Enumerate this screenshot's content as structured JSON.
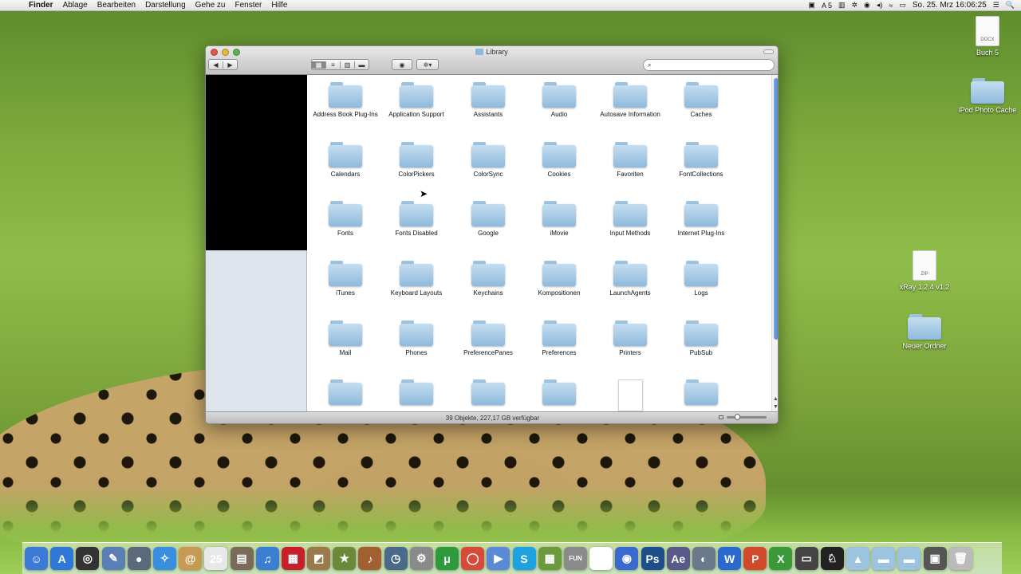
{
  "menubar": {
    "apple": "",
    "menus": [
      "Finder",
      "Ablage",
      "Bearbeiten",
      "Darstellung",
      "Gehe zu",
      "Fenster",
      "Hilfe"
    ],
    "status_icons": [
      "▣",
      "A 5",
      "▥",
      "✲",
      "◉",
      "◂)",
      "≈",
      "▭"
    ],
    "clock": "So. 25. Mrz  16:06:25",
    "search_icon": "🔍",
    "list_icon": "☰"
  },
  "desktop": {
    "icons": [
      {
        "label": "Buch 5",
        "badge": "DOCX"
      },
      {
        "label": "iPod Photo Cache"
      },
      {
        "label": "xRay 1.2.4 v1.2",
        "badge": "ZIP"
      },
      {
        "label": "Neuer Ordner"
      }
    ]
  },
  "window": {
    "title": "Library",
    "toolbar": {
      "back": "◀",
      "forward": "▶",
      "views": [
        "▦",
        "≡",
        "▥",
        "▬"
      ],
      "quicklook": "◉",
      "action": "✲▾",
      "search_icon": "⌕",
      "search_placeholder": ""
    },
    "status": "39 Objekte, 227,17 GB verfügbar",
    "scroll_up": "▲",
    "scroll_down": "▼",
    "items": [
      "Address Book Plug-Ins",
      "Application Support",
      "Assistants",
      "Audio",
      "Autosave Information",
      "Caches",
      "Calendars",
      "ColorPickers",
      "ColorSync",
      "Cookies",
      "Favoriten",
      "FontCollections",
      "Fonts",
      "Fonts Disabled",
      "Google",
      "iMovie",
      "Input Methods",
      "Internet Plug-Ins",
      "iTunes",
      "Keyboard Layouts",
      "Keychains",
      "Kompositionen",
      "LaunchAgents",
      "Logs",
      "Mail",
      "Phones",
      "PreferencePanes",
      "Preferences",
      "Printers",
      "PubSub"
    ]
  },
  "cursor": "➤",
  "dock": {
    "icons": [
      {
        "glyph": "☺",
        "color": "#3b7bd6"
      },
      {
        "glyph": "A",
        "color": "#2f78d8"
      },
      {
        "glyph": "◎",
        "color": "#333333"
      },
      {
        "glyph": "✎",
        "color": "#5a7fb5"
      },
      {
        "glyph": "●",
        "color": "#5a6a7a"
      },
      {
        "glyph": "✧",
        "color": "#3a8ee0"
      },
      {
        "glyph": "@",
        "color": "#c79a52"
      },
      {
        "glyph": "25",
        "color": "#e8e8e8"
      },
      {
        "glyph": "▤",
        "color": "#7a6a5a"
      },
      {
        "glyph": "♫",
        "color": "#3a7fd0"
      },
      {
        "glyph": "▦",
        "color": "#c8202a"
      },
      {
        "glyph": "◩",
        "color": "#9a7a4a"
      },
      {
        "glyph": "★",
        "color": "#6a8a3a"
      },
      {
        "glyph": "♪",
        "color": "#a06030"
      },
      {
        "glyph": "◷",
        "color": "#4a6a8a"
      },
      {
        "glyph": "⚙",
        "color": "#8a8a8a"
      },
      {
        "glyph": "μ",
        "color": "#2e9a3e"
      },
      {
        "glyph": "◯",
        "color": "#d64a3a"
      },
      {
        "glyph": "▶",
        "color": "#5a8ad6"
      },
      {
        "glyph": "S",
        "color": "#1da1e0"
      },
      {
        "glyph": "▩",
        "color": "#6a9a3a"
      },
      {
        "glyph": "FUN",
        "color": "#8a8a8a"
      },
      {
        "glyph": "♜",
        "color": "#ffffff"
      },
      {
        "glyph": "◉",
        "color": "#3a6ad0"
      },
      {
        "glyph": "Ps",
        "color": "#1d4d8a"
      },
      {
        "glyph": "Ae",
        "color": "#5a5a8a"
      },
      {
        "glyph": "◐",
        "color": "#6a7a8a"
      },
      {
        "glyph": "W",
        "color": "#2a6ad0"
      },
      {
        "glyph": "P",
        "color": "#d04a2a"
      },
      {
        "glyph": "X",
        "color": "#3a9a3a"
      },
      {
        "glyph": "▭",
        "color": "#444444"
      },
      {
        "glyph": "♘",
        "color": "#222222"
      },
      {
        "glyph": "▲",
        "color": "#9cc3e0"
      },
      {
        "glyph": "▬",
        "color": "#9cc3e0"
      },
      {
        "glyph": "▬",
        "color": "#9cc3e0"
      },
      {
        "glyph": "▣",
        "color": "#555555"
      },
      {
        "glyph": "🗑",
        "color": "#bbbbbb"
      }
    ]
  }
}
